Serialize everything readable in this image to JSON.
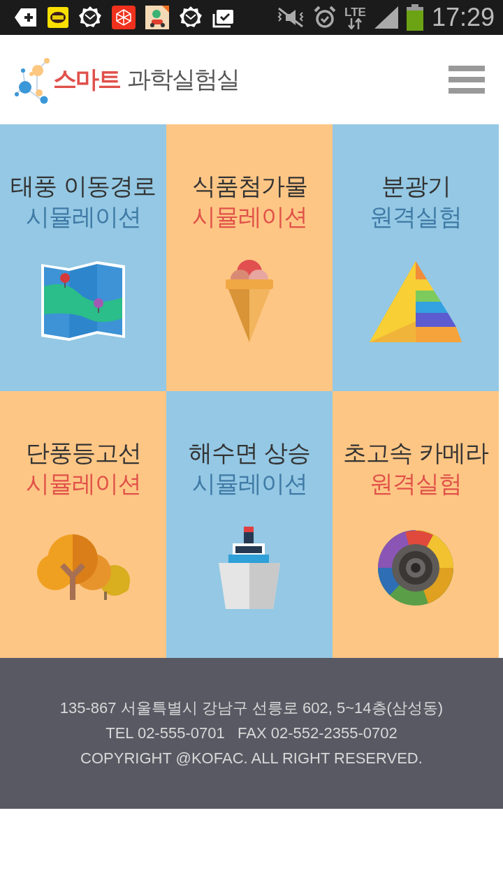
{
  "status_bar": {
    "notifications": [
      {
        "kind": "add"
      },
      {
        "kind": "talk"
      },
      {
        "kind": "mail"
      },
      {
        "kind": "app"
      },
      {
        "kind": "game"
      },
      {
        "kind": "mail"
      },
      {
        "kind": "task"
      }
    ],
    "lte": "LTE",
    "time": "17:29"
  },
  "header": {
    "logo_accent": "스마트",
    "logo_text": "과학실험실"
  },
  "tiles": [
    {
      "title": "태풍 이동경로",
      "subtitle": "시뮬레이션",
      "color": "#94c8e4",
      "kind": "map"
    },
    {
      "title": "식품첨가물",
      "subtitle": "시뮬레이션",
      "color": "#fec685",
      "kind": "icecream"
    },
    {
      "title": "분광기",
      "subtitle": "원격실험",
      "color": "#94c8e4",
      "kind": "prism"
    },
    {
      "title": "단풍등고선",
      "subtitle": "시뮬레이션",
      "color": "#fec685",
      "kind": "tree"
    },
    {
      "title": "해수면 상승",
      "subtitle": "시뮬레이션",
      "color": "#94c8e4",
      "kind": "ship"
    },
    {
      "title": "초고속 카메라",
      "subtitle": "원격실험",
      "color": "#fec685",
      "kind": "camera"
    }
  ],
  "footer": [
    "135-867 서울특별시 강남구 선릉로 602, 5~14층(삼성동)",
    "TEL 02-555-0701   FAX 02-552-2355-0702",
    "COPYRIGHT @KOFAC. ALL RIGHT RESERVED."
  ]
}
